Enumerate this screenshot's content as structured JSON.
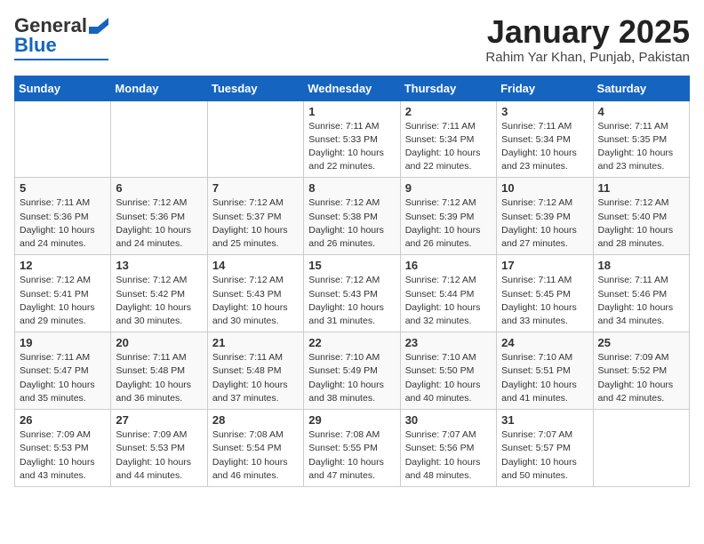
{
  "header": {
    "logo_general": "General",
    "logo_blue": "Blue",
    "title": "January 2025",
    "subtitle": "Rahim Yar Khan, Punjab, Pakistan"
  },
  "weekdays": [
    "Sunday",
    "Monday",
    "Tuesday",
    "Wednesday",
    "Thursday",
    "Friday",
    "Saturday"
  ],
  "weeks": [
    [
      {
        "day": "",
        "sunrise": "",
        "sunset": "",
        "daylight": ""
      },
      {
        "day": "",
        "sunrise": "",
        "sunset": "",
        "daylight": ""
      },
      {
        "day": "",
        "sunrise": "",
        "sunset": "",
        "daylight": ""
      },
      {
        "day": "1",
        "sunrise": "Sunrise: 7:11 AM",
        "sunset": "Sunset: 5:33 PM",
        "daylight": "Daylight: 10 hours and 22 minutes."
      },
      {
        "day": "2",
        "sunrise": "Sunrise: 7:11 AM",
        "sunset": "Sunset: 5:34 PM",
        "daylight": "Daylight: 10 hours and 22 minutes."
      },
      {
        "day": "3",
        "sunrise": "Sunrise: 7:11 AM",
        "sunset": "Sunset: 5:34 PM",
        "daylight": "Daylight: 10 hours and 23 minutes."
      },
      {
        "day": "4",
        "sunrise": "Sunrise: 7:11 AM",
        "sunset": "Sunset: 5:35 PM",
        "daylight": "Daylight: 10 hours and 23 minutes."
      }
    ],
    [
      {
        "day": "5",
        "sunrise": "Sunrise: 7:11 AM",
        "sunset": "Sunset: 5:36 PM",
        "daylight": "Daylight: 10 hours and 24 minutes."
      },
      {
        "day": "6",
        "sunrise": "Sunrise: 7:12 AM",
        "sunset": "Sunset: 5:36 PM",
        "daylight": "Daylight: 10 hours and 24 minutes."
      },
      {
        "day": "7",
        "sunrise": "Sunrise: 7:12 AM",
        "sunset": "Sunset: 5:37 PM",
        "daylight": "Daylight: 10 hours and 25 minutes."
      },
      {
        "day": "8",
        "sunrise": "Sunrise: 7:12 AM",
        "sunset": "Sunset: 5:38 PM",
        "daylight": "Daylight: 10 hours and 26 minutes."
      },
      {
        "day": "9",
        "sunrise": "Sunrise: 7:12 AM",
        "sunset": "Sunset: 5:39 PM",
        "daylight": "Daylight: 10 hours and 26 minutes."
      },
      {
        "day": "10",
        "sunrise": "Sunrise: 7:12 AM",
        "sunset": "Sunset: 5:39 PM",
        "daylight": "Daylight: 10 hours and 27 minutes."
      },
      {
        "day": "11",
        "sunrise": "Sunrise: 7:12 AM",
        "sunset": "Sunset: 5:40 PM",
        "daylight": "Daylight: 10 hours and 28 minutes."
      }
    ],
    [
      {
        "day": "12",
        "sunrise": "Sunrise: 7:12 AM",
        "sunset": "Sunset: 5:41 PM",
        "daylight": "Daylight: 10 hours and 29 minutes."
      },
      {
        "day": "13",
        "sunrise": "Sunrise: 7:12 AM",
        "sunset": "Sunset: 5:42 PM",
        "daylight": "Daylight: 10 hours and 30 minutes."
      },
      {
        "day": "14",
        "sunrise": "Sunrise: 7:12 AM",
        "sunset": "Sunset: 5:43 PM",
        "daylight": "Daylight: 10 hours and 30 minutes."
      },
      {
        "day": "15",
        "sunrise": "Sunrise: 7:12 AM",
        "sunset": "Sunset: 5:43 PM",
        "daylight": "Daylight: 10 hours and 31 minutes."
      },
      {
        "day": "16",
        "sunrise": "Sunrise: 7:12 AM",
        "sunset": "Sunset: 5:44 PM",
        "daylight": "Daylight: 10 hours and 32 minutes."
      },
      {
        "day": "17",
        "sunrise": "Sunrise: 7:11 AM",
        "sunset": "Sunset: 5:45 PM",
        "daylight": "Daylight: 10 hours and 33 minutes."
      },
      {
        "day": "18",
        "sunrise": "Sunrise: 7:11 AM",
        "sunset": "Sunset: 5:46 PM",
        "daylight": "Daylight: 10 hours and 34 minutes."
      }
    ],
    [
      {
        "day": "19",
        "sunrise": "Sunrise: 7:11 AM",
        "sunset": "Sunset: 5:47 PM",
        "daylight": "Daylight: 10 hours and 35 minutes."
      },
      {
        "day": "20",
        "sunrise": "Sunrise: 7:11 AM",
        "sunset": "Sunset: 5:48 PM",
        "daylight": "Daylight: 10 hours and 36 minutes."
      },
      {
        "day": "21",
        "sunrise": "Sunrise: 7:11 AM",
        "sunset": "Sunset: 5:48 PM",
        "daylight": "Daylight: 10 hours and 37 minutes."
      },
      {
        "day": "22",
        "sunrise": "Sunrise: 7:10 AM",
        "sunset": "Sunset: 5:49 PM",
        "daylight": "Daylight: 10 hours and 38 minutes."
      },
      {
        "day": "23",
        "sunrise": "Sunrise: 7:10 AM",
        "sunset": "Sunset: 5:50 PM",
        "daylight": "Daylight: 10 hours and 40 minutes."
      },
      {
        "day": "24",
        "sunrise": "Sunrise: 7:10 AM",
        "sunset": "Sunset: 5:51 PM",
        "daylight": "Daylight: 10 hours and 41 minutes."
      },
      {
        "day": "25",
        "sunrise": "Sunrise: 7:09 AM",
        "sunset": "Sunset: 5:52 PM",
        "daylight": "Daylight: 10 hours and 42 minutes."
      }
    ],
    [
      {
        "day": "26",
        "sunrise": "Sunrise: 7:09 AM",
        "sunset": "Sunset: 5:53 PM",
        "daylight": "Daylight: 10 hours and 43 minutes."
      },
      {
        "day": "27",
        "sunrise": "Sunrise: 7:09 AM",
        "sunset": "Sunset: 5:53 PM",
        "daylight": "Daylight: 10 hours and 44 minutes."
      },
      {
        "day": "28",
        "sunrise": "Sunrise: 7:08 AM",
        "sunset": "Sunset: 5:54 PM",
        "daylight": "Daylight: 10 hours and 46 minutes."
      },
      {
        "day": "29",
        "sunrise": "Sunrise: 7:08 AM",
        "sunset": "Sunset: 5:55 PM",
        "daylight": "Daylight: 10 hours and 47 minutes."
      },
      {
        "day": "30",
        "sunrise": "Sunrise: 7:07 AM",
        "sunset": "Sunset: 5:56 PM",
        "daylight": "Daylight: 10 hours and 48 minutes."
      },
      {
        "day": "31",
        "sunrise": "Sunrise: 7:07 AM",
        "sunset": "Sunset: 5:57 PM",
        "daylight": "Daylight: 10 hours and 50 minutes."
      },
      {
        "day": "",
        "sunrise": "",
        "sunset": "",
        "daylight": ""
      }
    ]
  ]
}
